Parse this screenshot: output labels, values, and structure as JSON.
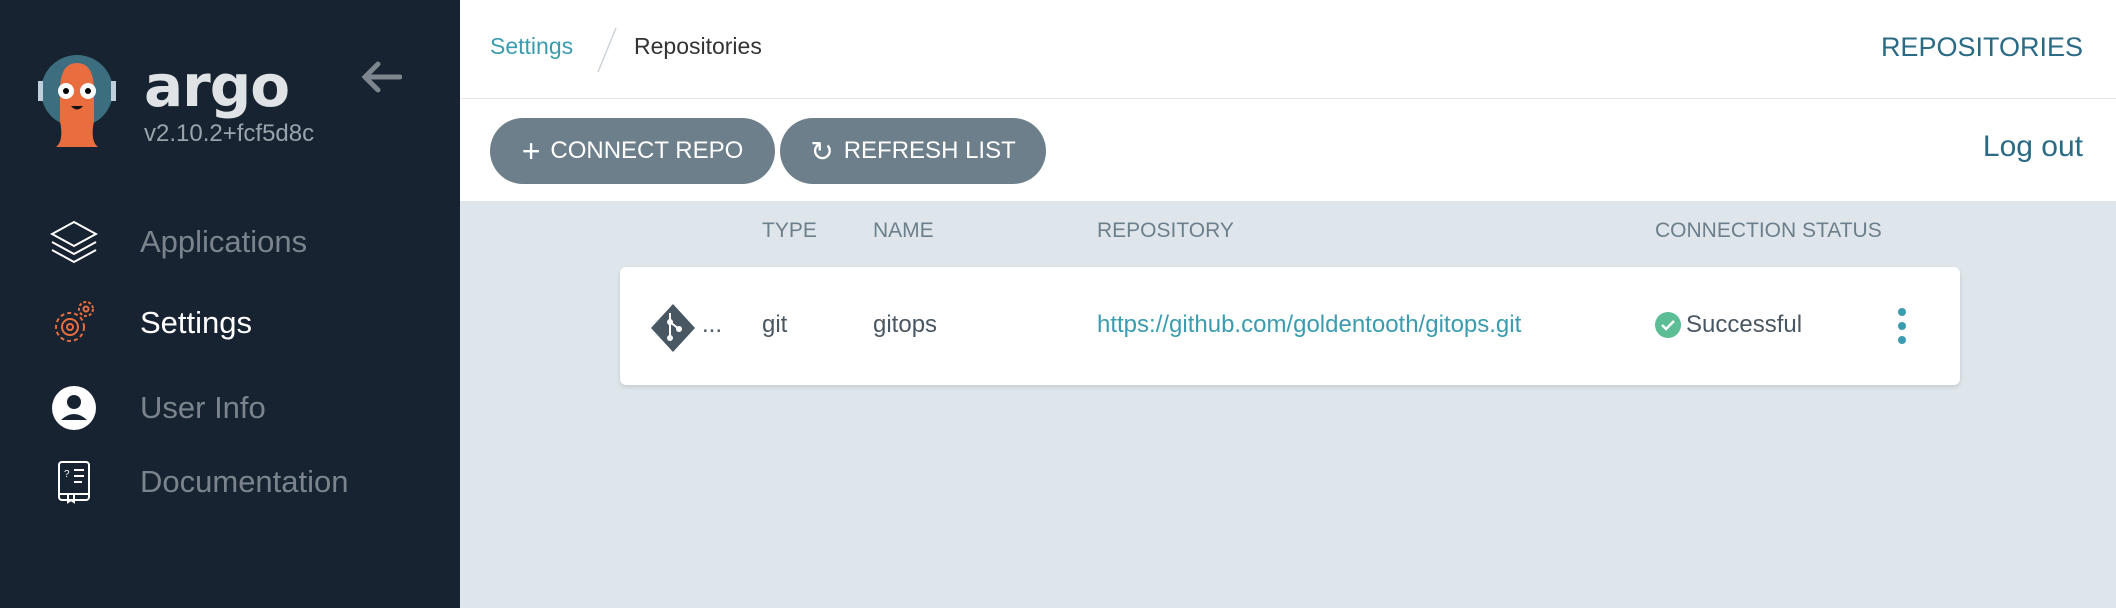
{
  "sidebar": {
    "brand": "argo",
    "version": "v2.10.2+fcf5d8c",
    "items": [
      {
        "label": "Applications",
        "icon": "layers-icon"
      },
      {
        "label": "Settings",
        "icon": "gear-icon",
        "active": true
      },
      {
        "label": "User Info",
        "icon": "user-icon"
      },
      {
        "label": "Documentation",
        "icon": "book-icon"
      }
    ]
  },
  "header": {
    "breadcrumb": [
      "Settings",
      "Repositories"
    ],
    "title": "REPOSITORIES"
  },
  "toolbar": {
    "connect": "CONNECT REPO",
    "refresh": "REFRESH LIST",
    "logout": "Log out"
  },
  "table": {
    "columns": [
      "TYPE",
      "NAME",
      "REPOSITORY",
      "CONNECTION STATUS"
    ],
    "rows": [
      {
        "icon_text": "...",
        "type": "git",
        "name": "gitops",
        "repository": "https://github.com/goldentooth/gitops.git",
        "status": "Successful"
      }
    ]
  },
  "colors": {
    "sidebar": "#172330",
    "accent": "#3a9cb0",
    "success": "#5dbd95",
    "brand_orange": "#e96d3f"
  }
}
